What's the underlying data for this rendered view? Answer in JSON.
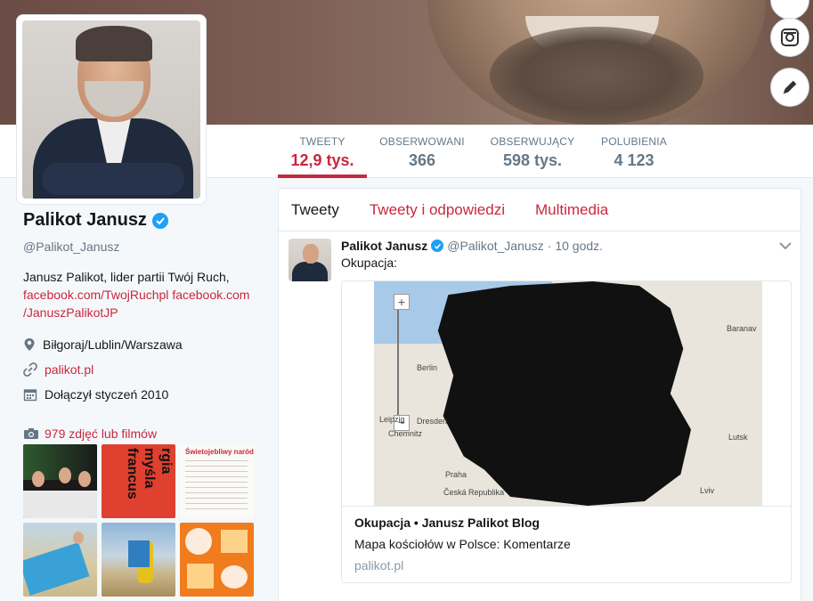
{
  "profile": {
    "name": "Palikot Janusz",
    "handle": "@Palikot_Janusz",
    "bio_text": "Janusz Palikot, lider partii Twój Ruch,",
    "bio_link1": "facebook.com/TwojRuchpl",
    "bio_link2a": "facebook.com",
    "bio_link2b": "/JanuszPalikotJP",
    "location": "Biłgoraj/Lublin/Warszawa",
    "website": "palikot.pl",
    "joined": "Dołączył styczeń 2010",
    "photos_label": "979 zdjęć lub filmów"
  },
  "stats": [
    {
      "label": "TWEETY",
      "value": "12,9 tys."
    },
    {
      "label": "OBSERWOWANI",
      "value": "366"
    },
    {
      "label": "OBSERWUJĄCY",
      "value": "598 tys."
    },
    {
      "label": "POLUBIENIA",
      "value": "4 123"
    }
  ],
  "timeline_tabs": [
    "Tweety",
    "Tweety i odpowiedzi",
    "Multimedia"
  ],
  "tweet": {
    "name": "Palikot Janusz",
    "handle": "@Palikot_Janusz",
    "dot": "·",
    "time": "10 godz.",
    "text": "Okupacja:",
    "card_title": "Okupacja • Janusz Palikot Blog",
    "card_desc": "Mapa kościołów w Polsce: Komentarze",
    "card_domain": "palikot.pl",
    "map_labels": [
      "Berlin",
      "Leipzig",
      "Dresden",
      "Chemnitz",
      "Praha",
      "Česká Republika",
      "Lutsk",
      "Baranav",
      "Lviv"
    ]
  },
  "thumbs": [
    {
      "text": ""
    },
    {
      "text": "rgia myśla francus"
    },
    {
      "text": "Świetojebliwy naród"
    },
    {
      "text": ""
    },
    {
      "text": ""
    },
    {
      "text": ""
    }
  ],
  "colors": {
    "accent": "#c9283e",
    "verified": "#1da1f2",
    "muted": "#657786"
  },
  "icons": [
    "camera-icon",
    "edit-icon",
    "verified-icon",
    "location-icon",
    "link-icon",
    "calendar-icon",
    "photo-icon",
    "chevron-down-icon"
  ]
}
